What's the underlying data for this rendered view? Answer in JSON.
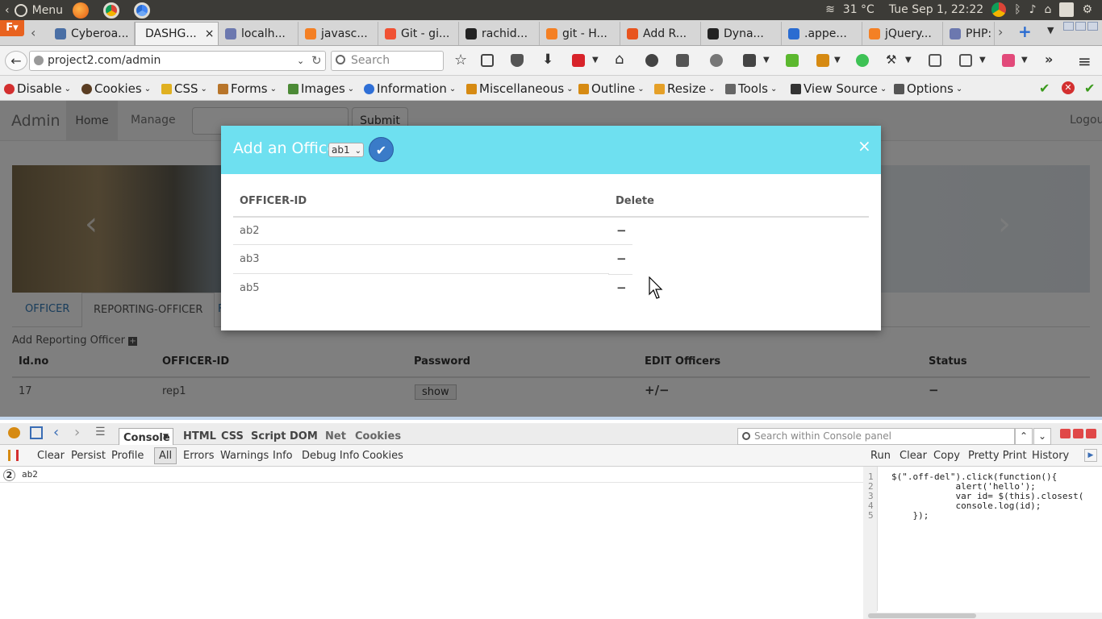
{
  "os": {
    "menu_label": "Menu",
    "weather": "31 °C",
    "datetime": "Tue Sep  1, 22:22"
  },
  "tabs": [
    {
      "label": "Cyberoa...",
      "color": "#4a6fa5"
    },
    {
      "label": "DASHG...",
      "color": "#f7931e",
      "active": true
    },
    {
      "label": "localh...",
      "color": "#6c78af"
    },
    {
      "label": "javasc...",
      "color": "#f48024"
    },
    {
      "label": "Git - gi...",
      "color": "#f05133"
    },
    {
      "label": "rachid...",
      "color": "#222222"
    },
    {
      "label": "git - H...",
      "color": "#f48024"
    },
    {
      "label": "Add R...",
      "color": "#e8541e"
    },
    {
      "label": "Dyna...",
      "color": "#222222"
    },
    {
      "label": ".appe...",
      "color": "#2a6cd1"
    },
    {
      "label": "jQuery...",
      "color": "#f48024"
    },
    {
      "label": "PHP:",
      "color": "#6c78af"
    }
  ],
  "nav": {
    "url": "project2.com/admin",
    "search_placeholder": "Search"
  },
  "webdev": {
    "items": [
      "Disable",
      "Cookies",
      "CSS",
      "Forms",
      "Images",
      "Information",
      "Miscellaneous",
      "Outline",
      "Resize",
      "Tools",
      "View Source",
      "Options"
    ]
  },
  "site": {
    "brand": "Admin",
    "nav_home": "Home",
    "nav_manage": "Manage",
    "submit": "Submit",
    "logout": "Logout",
    "tab_officer": "OFFICER",
    "tab_reporting": "REPORTING-OFFICER",
    "tab_third": "F",
    "add_reporting": "Add Reporting Officer",
    "table_headers": [
      "Id.no",
      "OFFICER-ID",
      "Password",
      "EDIT Officers",
      "Status"
    ],
    "table_row": {
      "id": "17",
      "officer": "rep1",
      "password_button": "show",
      "edit": "+/−",
      "status": "−"
    }
  },
  "modal": {
    "title": "Add an Officer",
    "select_value": "ab1",
    "close": "×",
    "col_officer": "OFFICER-ID",
    "col_delete": "Delete",
    "rows": [
      {
        "id": "ab2",
        "delete": "−"
      },
      {
        "id": "ab3",
        "delete": "−"
      },
      {
        "id": "ab5",
        "delete": "−"
      }
    ]
  },
  "devtools": {
    "tabs": [
      "Console",
      "HTML",
      "CSS",
      "Script",
      "DOM",
      "Net",
      "Cookies"
    ],
    "sub": [
      "Clear",
      "Persist",
      "Profile",
      "All",
      "Errors",
      "Warnings",
      "Info",
      "Debug Info",
      "Cookies"
    ],
    "search_placeholder": "Search within Console panel",
    "right_actions": [
      "Run",
      "Clear",
      "Copy",
      "Pretty Print",
      "History"
    ],
    "log_count": "2",
    "log_text": "ab2",
    "code_lines": [
      "$(\".off-del\").click(function(){",
      "            alert('hello');",
      "            var id= $(this).closest(",
      "            console.log(id);",
      "    });"
    ]
  }
}
